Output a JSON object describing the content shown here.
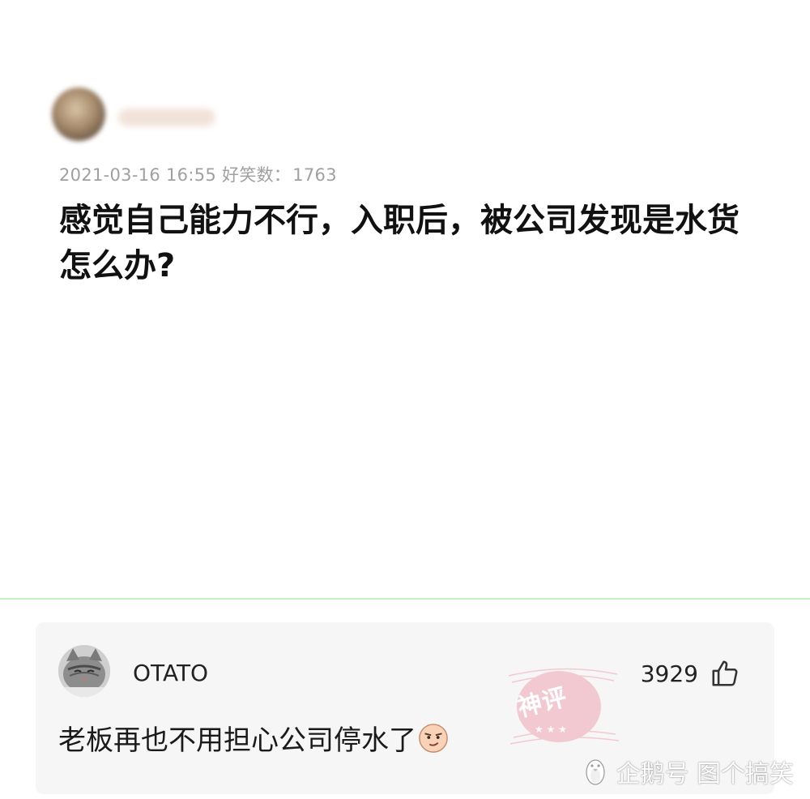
{
  "post": {
    "author_name": "",
    "date": "2021-03-16 16:55",
    "score_label": "好笑数：",
    "score_value": "1763",
    "title": "感觉自己能力不行，入职后，被公司发现是水货怎么办?"
  },
  "comment": {
    "username": "OTATO",
    "like_count": "3929",
    "text": "老板再也不用担心公司停水了"
  },
  "stamp": {
    "text": "神评"
  },
  "watermark": {
    "text": "企鹅号 图个搞笑"
  },
  "colors": {
    "divider": "#c9eec3",
    "card_bg": "#f6f6f6",
    "meta_text": "#a0a0a0",
    "stamp": "#f2a6b4"
  },
  "icons": {
    "like": "thumbs-up-icon",
    "emoji": "smirk-face-icon",
    "watermark": "penguin-icon"
  }
}
